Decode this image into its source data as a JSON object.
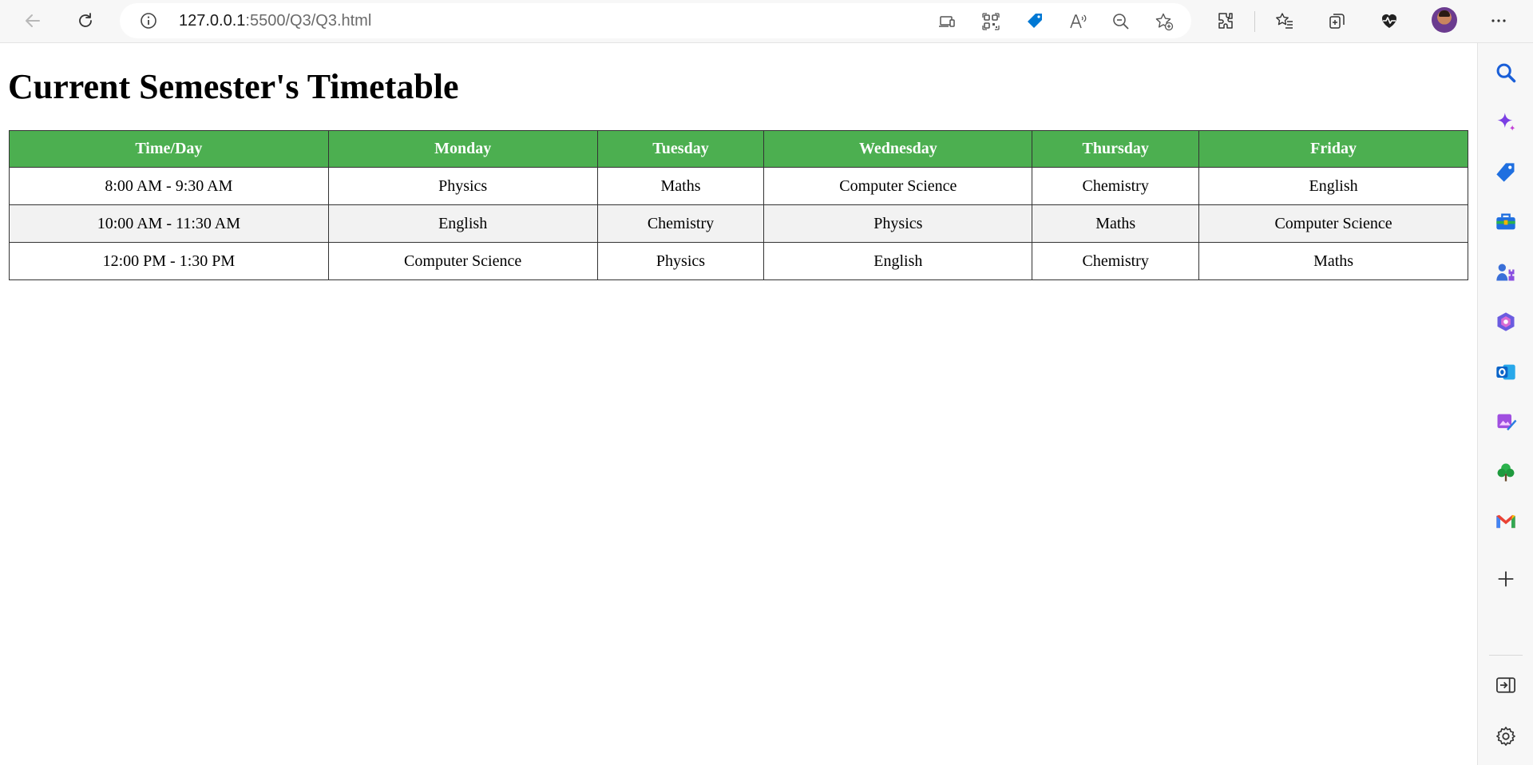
{
  "browser": {
    "url_host": "127.0.0.1",
    "url_path": ":5500/Q3/Q3.html",
    "accent_color": "#0078d4"
  },
  "toolbar_icons": [
    "back-arrow-icon",
    "refresh-icon",
    "site-info-icon",
    "app-available-icon",
    "qr-code-icon",
    "price-tag-icon",
    "read-aloud-icon",
    "zoom-out-icon",
    "add-favorite-icon",
    "extensions-icon",
    "favorites-icon",
    "collections-icon",
    "browser-essentials-icon",
    "profile-avatar",
    "more-menu-icon"
  ],
  "page": {
    "title": "Current Semester's Timetable",
    "header_color": "#4caf50",
    "stripe_color": "#f2f2f2"
  },
  "timetable": {
    "headers": [
      "Time/Day",
      "Monday",
      "Tuesday",
      "Wednesday",
      "Thursday",
      "Friday"
    ],
    "rows": [
      [
        "8:00 AM - 9:30 AM",
        "Physics",
        "Maths",
        "Computer Science",
        "Chemistry",
        "English"
      ],
      [
        "10:00 AM - 11:30 AM",
        "English",
        "Chemistry",
        "Physics",
        "Maths",
        "Computer Science"
      ],
      [
        "12:00 PM - 1:30 PM",
        "Computer Science",
        "Physics",
        "English",
        "Chemistry",
        "Maths"
      ]
    ]
  },
  "sidebar_icons": [
    "search-icon",
    "copilot-icon",
    "shopping-icon",
    "tools-icon",
    "games-icon",
    "microsoft-365-icon",
    "outlook-icon",
    "designer-icon",
    "tree-icon",
    "gmail-icon",
    "add-icon",
    "hide-sidebar-icon",
    "settings-icon"
  ]
}
